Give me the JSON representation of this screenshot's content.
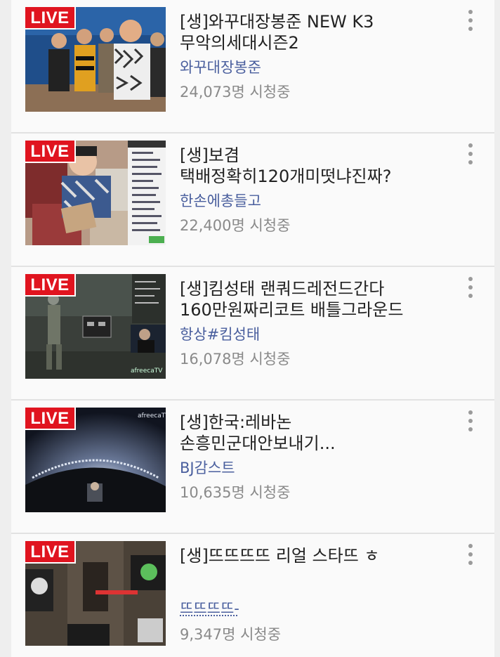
{
  "live_label": "LIVE",
  "items": [
    {
      "title": "[생]와꾸대장봉준 NEW K3\n무악의세대시즌2",
      "bj": "와꾸대장봉준",
      "viewers": "24,073명 시청중"
    },
    {
      "title": "[생]보겸\n택배정확히120개미떳냐진짜?",
      "bj": "한손에총들고",
      "viewers": "22,400명 시청중"
    },
    {
      "title": "[생]킴성태 랜쿼드레전드간다\n160만원짜리코트 배틀그라운드",
      "bj": "항상#킴성태",
      "viewers": "16,078명 시청중"
    },
    {
      "title": "[생]한국:레바논\n손흥민군대안보내기...",
      "bj": "BJ감스트",
      "viewers": "10,635명 시청중"
    },
    {
      "title": "[생]뜨뜨뜨뜨 리얼 스타뜨 ㅎ",
      "bj": "뜨뜨뜨뜨-",
      "viewers": "9,347명 시청중"
    }
  ],
  "colors": {
    "live_badge": "#e0141f",
    "bj_name": "#4a5f9e",
    "viewers": "#8a8a8a"
  }
}
